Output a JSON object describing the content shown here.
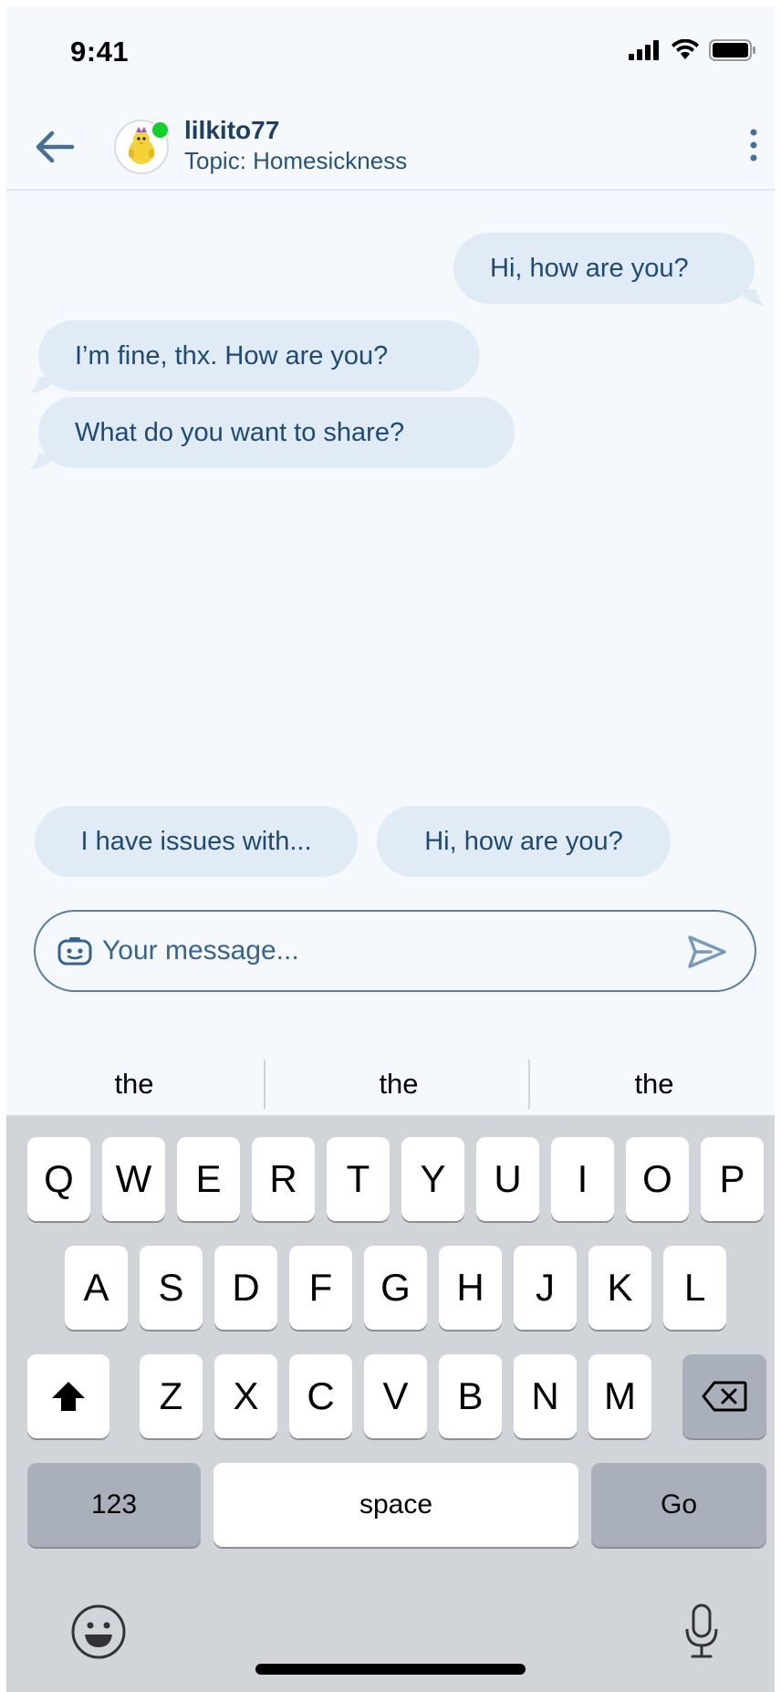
{
  "status_bar": {
    "time": "9:41"
  },
  "header": {
    "username": "lilkito77",
    "topic": "Topic: Homesickness",
    "avatar_icon": "chick-avatar-icon",
    "online_color": "#12d12a"
  },
  "messages": [
    {
      "side": "right",
      "text": "Hi, how are you?"
    },
    {
      "side": "left",
      "text": "I’m fine, thx. How are you?"
    },
    {
      "side": "left",
      "text": "What do you want to share?"
    }
  ],
  "suggestions": [
    "I have issues with...",
    "Hi, how are you?"
  ],
  "composer": {
    "placeholder": "Your message...",
    "value": ""
  },
  "predictions": [
    "the",
    "the",
    "the"
  ],
  "keyboard": {
    "row1": [
      "Q",
      "W",
      "E",
      "R",
      "T",
      "Y",
      "U",
      "I",
      "O",
      "P"
    ],
    "row2": [
      "A",
      "S",
      "D",
      "F",
      "G",
      "H",
      "J",
      "K",
      "L"
    ],
    "row3": [
      "Z",
      "X",
      "C",
      "V",
      "B",
      "N",
      "M"
    ],
    "numbers_label": "123",
    "space_label": "space",
    "go_label": "Go"
  },
  "colors": {
    "accent": "#1e4a73",
    "bubble": "#e1ebf5",
    "background": "#f5f9fd",
    "keyboard": "#d1d4d9"
  }
}
